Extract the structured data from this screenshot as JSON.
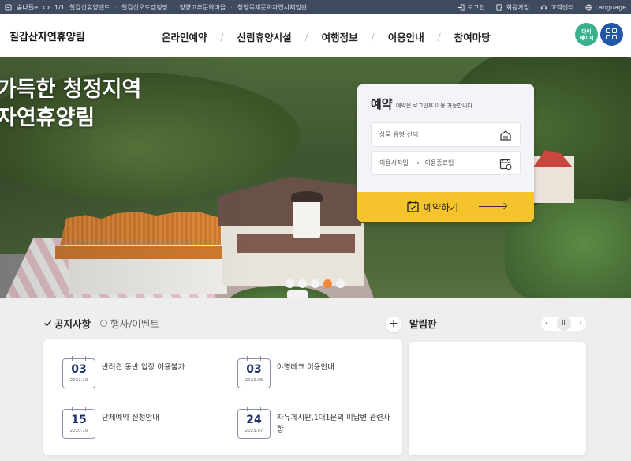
{
  "topbar": {
    "home_label": "숲나들e",
    "page_indicator": "1/1",
    "sites": [
      "칠갑산휴양랜드",
      "칠갑산오토캠핑장",
      "청양고추문화마을",
      "청양목재문화자연사체험관"
    ],
    "login": "로그인",
    "signup": "회원가입",
    "support": "고객센터",
    "language": "Language"
  },
  "header": {
    "logo": "칠갑산자연휴양림",
    "menu": [
      "온라인예약",
      "산림휴양시설",
      "여행정보",
      "이용안내",
      "참여마당"
    ],
    "mypage_line1": "마이",
    "mypage_line2": "페이지"
  },
  "hero": {
    "tagline_line1": "가득한 청정지역",
    "tagline_line2": "자연휴양림",
    "slide_count": 5,
    "active_slide": 4
  },
  "reservation": {
    "title": "예약",
    "note": "예약은 로그인후 이용 가능합니다.",
    "product_type": "상품 유형 선택",
    "start_date": "이용시작일",
    "arrow": "→",
    "end_date": "이용종료일",
    "book_button": "예약하기"
  },
  "tabs": {
    "notice": "공지사항",
    "events": "행사/이벤트",
    "plus": "+"
  },
  "notices": [
    {
      "day": "03",
      "ym": "2022.10",
      "title": "반려견 동반 입장 이용불가"
    },
    {
      "day": "03",
      "ym": "2022.06",
      "title": "야영데크 이용안내"
    },
    {
      "day": "15",
      "ym": "2020.10",
      "title": "단체예약 신청안내"
    },
    {
      "day": "24",
      "ym": "2023.07",
      "title": "자유게시판,1대1문의 미답변 관련사항"
    }
  ],
  "board": {
    "title": "알림판",
    "prev": "‹",
    "pause": "II",
    "next": "›"
  },
  "colors": {
    "topbar_bg": "#3e4a5e",
    "book_button": "#f5c42c",
    "active_dot": "#f0883a",
    "mypage": "#3bb08f",
    "allmenu": "#2456a8",
    "date_navy": "#1c2f6d"
  }
}
